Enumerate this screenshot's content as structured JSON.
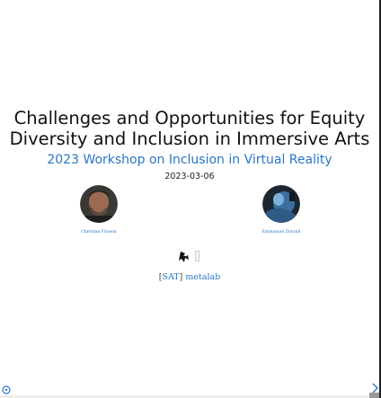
{
  "slide": {
    "title_line1": "Challenges and Opportunities for Equity",
    "title_line2": "Diversity and Inclusion in Immersive Arts",
    "subtitle": "2023 Workshop on Inclusion in Virtual Reality",
    "date": "2023-03-06",
    "authors": [
      {
        "name": "Christian Frisson",
        "avatar_icon": "person-photo"
      },
      {
        "name": "Emmanuel Durand",
        "avatar_icon": "person-photo"
      }
    ],
    "logos": [
      "sat-logo",
      "small-logo"
    ],
    "links": {
      "bracket_open": "[",
      "sat": "SAT",
      "bracket_close": "]",
      "metalab": "metalab"
    }
  },
  "controls": {
    "help_icon": "help-icon",
    "next_icon": "chevron-right-icon",
    "progress": 0
  },
  "colors": {
    "accent": "#2a76c6",
    "text": "#111111"
  }
}
